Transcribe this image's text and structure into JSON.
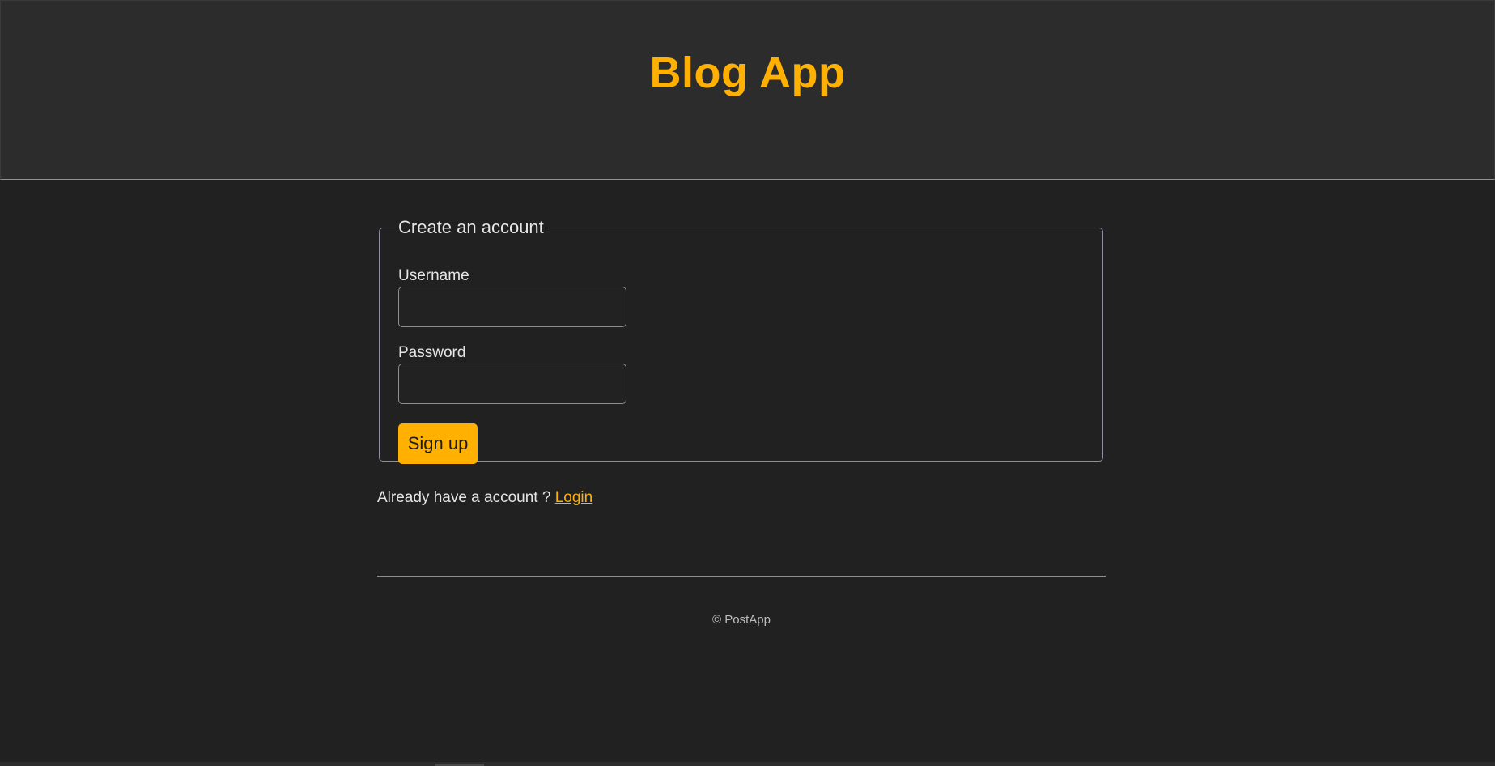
{
  "header": {
    "title": "Blog App"
  },
  "signup_form": {
    "legend": "Create an account",
    "username_label": "Username",
    "username_value": "",
    "password_label": "Password",
    "password_value": "",
    "submit_label": "Sign up"
  },
  "login_prompt": {
    "text": "Already have a account ?",
    "link_label": "Login"
  },
  "footer": {
    "text": "© PostApp"
  },
  "colors": {
    "accent": "#ffb000",
    "background": "#212121",
    "header_background": "#2c2c2c"
  }
}
